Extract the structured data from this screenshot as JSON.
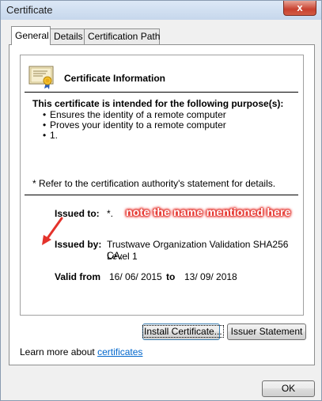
{
  "window": {
    "title": "Certificate",
    "close_label": "x"
  },
  "tabs": [
    {
      "label": "General",
      "active": true
    },
    {
      "label": "Details",
      "active": false
    },
    {
      "label": "Certification Path",
      "active": false
    }
  ],
  "info": {
    "title": "Certificate Information",
    "purpose_heading": "This certificate is intended for the following purpose(s):",
    "purposes": [
      "Ensures the identity of a remote computer",
      "Proves your identity to a remote computer",
      "1."
    ],
    "refer_note": "* Refer to the certification authority's statement for details.",
    "issued_to_label": "Issued to:",
    "issued_to_value": "*.",
    "issued_by_label": "Issued by:",
    "issued_by_value_line1": "Trustwave Organization Validation SHA256 CA,",
    "issued_by_value_line2": "Level 1",
    "valid_from_label": "Valid from",
    "valid_from_value": "16/ 06/ 2015",
    "valid_to_label": "to",
    "valid_to_value": "13/ 09/ 2018"
  },
  "annotation": {
    "text": "note the name mentioned here",
    "color": "#e4322b"
  },
  "buttons": {
    "install": "Install Certificate...",
    "issuer_statement": "Issuer Statement",
    "ok": "OK"
  },
  "learn_more": {
    "prefix": "Learn more about",
    "link": "certificates"
  }
}
